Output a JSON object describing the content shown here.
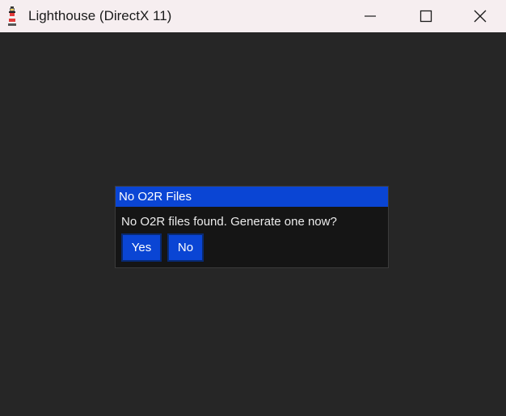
{
  "window": {
    "title": "Lighthouse (DirectX 11)",
    "icon": "lighthouse-icon",
    "controls": {
      "minimize": "minimize-icon",
      "maximize": "maximize-icon",
      "close": "close-icon"
    }
  },
  "dialog": {
    "title": "No O2R Files",
    "message": "No O2R files found. Generate one now?",
    "buttons": {
      "yes": "Yes",
      "no": "No"
    }
  },
  "colors": {
    "titlebar_bg": "#f6eef0",
    "client_bg": "#262626",
    "dialog_bg": "#151515",
    "accent": "#0a45d4",
    "button_border": "#082a73"
  }
}
